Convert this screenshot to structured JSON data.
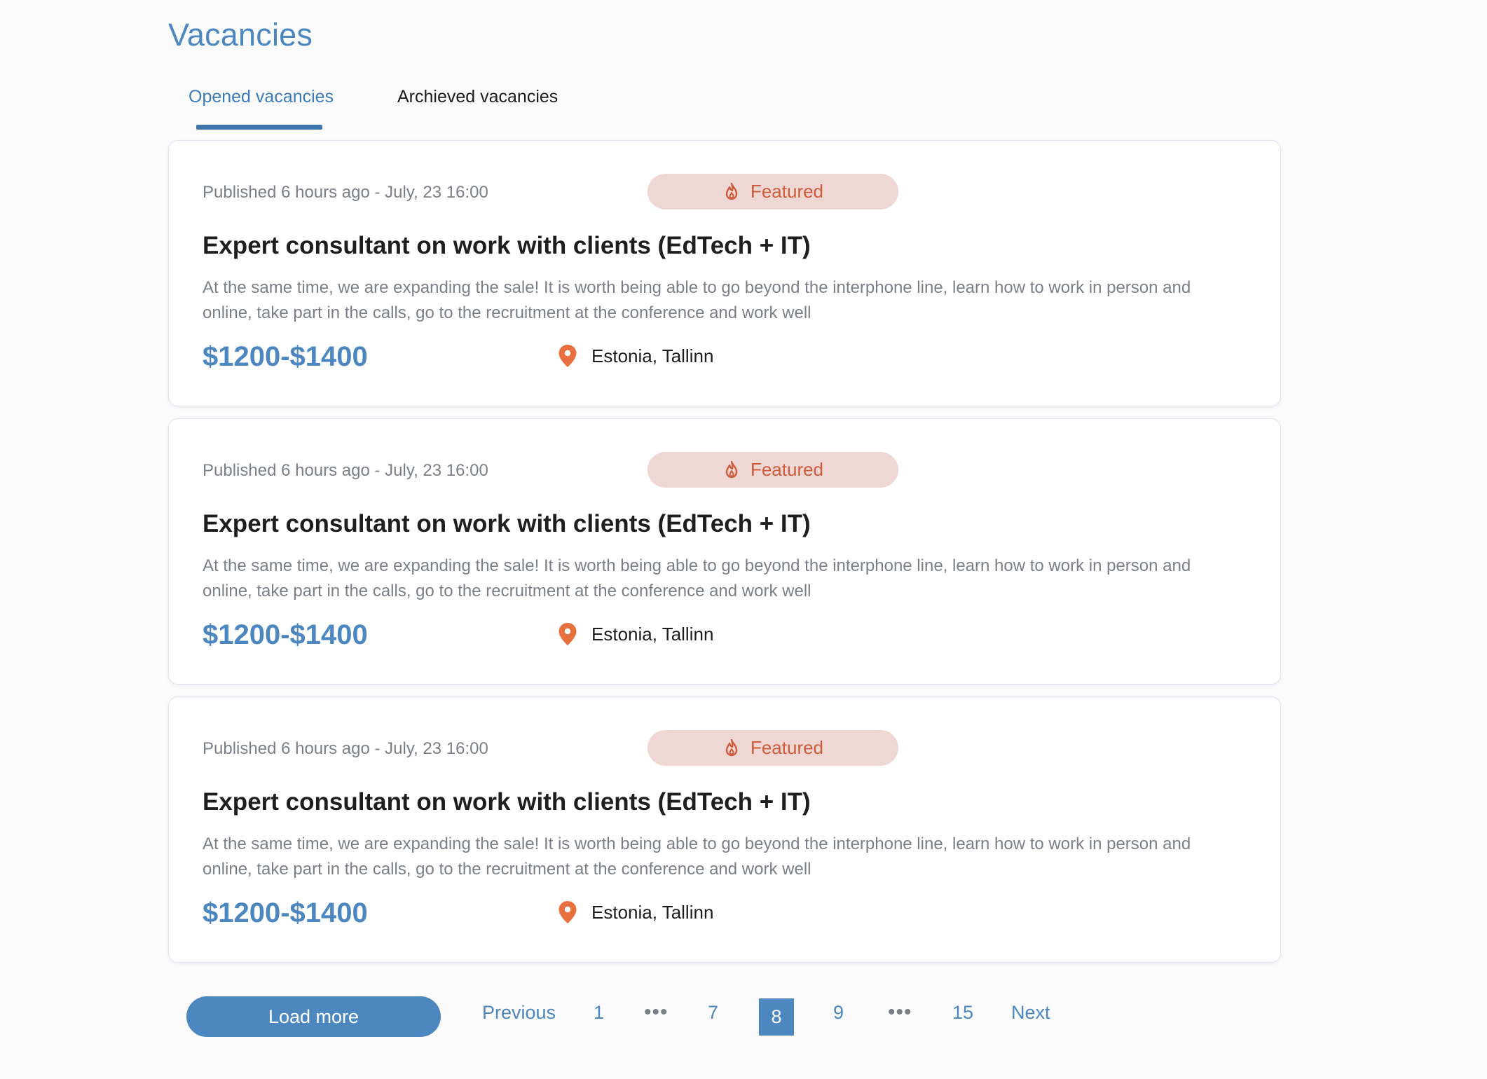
{
  "page": {
    "title": "Vacancies"
  },
  "tabs": [
    {
      "label": "Opened vacancies",
      "active": true
    },
    {
      "label": "Archieved vacancies",
      "active": false
    }
  ],
  "vacancies": [
    {
      "published": "Published 6 hours ago - July, 23 16:00",
      "badge": "Featured",
      "title": "Expert consultant on work with clients (EdTech + IT)",
      "description": "At the same time, we are expanding the sale! It is worth being able to go beyond the interphone line, learn how to work in person and online, take part in the calls, go to the recruitment at the conference and work well",
      "salary": "$1200-$1400",
      "location": "Estonia, Tallinn"
    },
    {
      "published": "Published 6 hours ago - July, 23 16:00",
      "badge": "Featured",
      "title": "Expert consultant on work with clients (EdTech + IT)",
      "description": "At the same time, we are expanding the sale! It is worth being able to go beyond the interphone line, learn how to work in person and online, take part in the calls, go to the recruitment at the conference and work well",
      "salary": "$1200-$1400",
      "location": "Estonia, Tallinn"
    },
    {
      "published": "Published 6 hours ago - July, 23 16:00",
      "badge": "Featured",
      "title": "Expert consultant on work with clients (EdTech + IT)",
      "description": "At the same time, we are expanding the sale! It is worth being able to go beyond the interphone line, learn how to work in person and online, take part in the calls, go to the recruitment at the conference and work well",
      "salary": "$1200-$1400",
      "location": "Estonia, Tallinn"
    }
  ],
  "icons": {
    "badge": "fire-icon",
    "location": "location-pin-icon"
  },
  "pagination": {
    "load_more": "Load more",
    "previous": "Previous",
    "next": "Next",
    "pages": [
      "1",
      "7",
      "8",
      "9",
      "15"
    ],
    "current": "8",
    "ellipsis": "•••"
  },
  "colors": {
    "accent": "#4c87c0",
    "badge_bg": "#efd8d4",
    "badge_text": "#cf5b3d",
    "pin": "#e8703f"
  }
}
